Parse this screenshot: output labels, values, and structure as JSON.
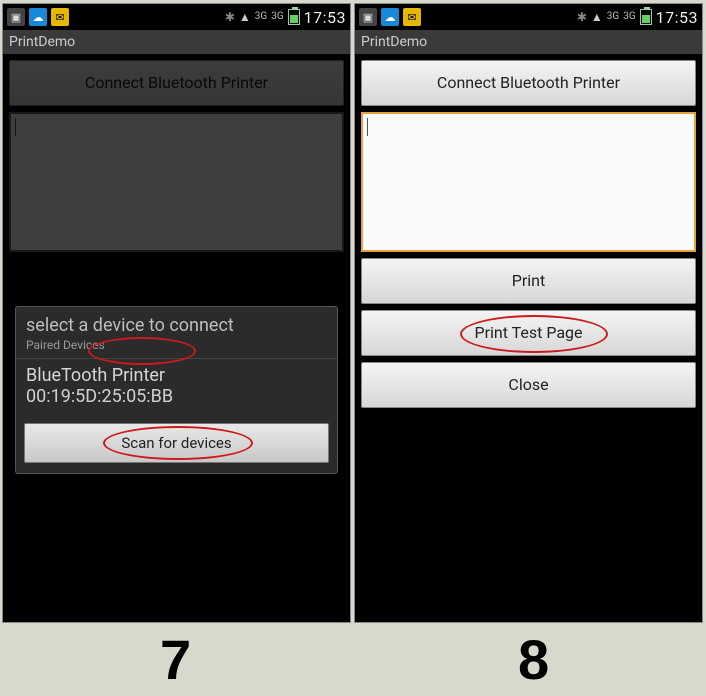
{
  "statusbar": {
    "time": "17:53",
    "net1": "3G",
    "net2": "3G"
  },
  "app_title": "PrintDemo",
  "buttons": {
    "connect": "Connect Bluetooth Printer",
    "print": "Print",
    "print_test": "Print Test Page",
    "close": "Close",
    "scan": "Scan for devices"
  },
  "dialog": {
    "title": "select a device to connect",
    "subtitle": "Paired Devices",
    "device_name": "BlueTooth Printer",
    "device_mac": "00:19:5D:25:05:BB"
  },
  "steps": {
    "left": "7",
    "right": "8"
  }
}
